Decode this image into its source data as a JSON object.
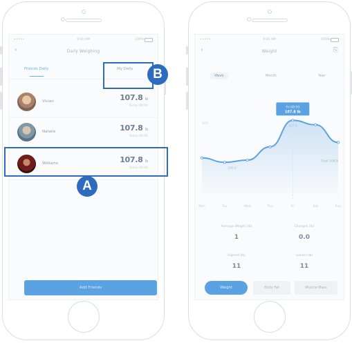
{
  "left_screen": {
    "status": {
      "signal": "•••••",
      "time": "9:41 AM",
      "battery": "100%"
    },
    "nav": {
      "back_icon": "‹",
      "title": "Daily Weighing"
    },
    "tabs": [
      {
        "label": "Friends Daily",
        "active": true
      },
      {
        "label": "My Daily",
        "active": false
      }
    ],
    "friends": [
      {
        "name": "Vivian",
        "value": "107.8",
        "unit": "lb",
        "sub": "Today 08:00"
      },
      {
        "name": "Natalie",
        "value": "107.8",
        "unit": "lb",
        "sub": "Today 08:00"
      },
      {
        "name": "Williams",
        "value": "107.8",
        "unit": "lb",
        "sub": "Today 08:00"
      }
    ],
    "add_button": "Add Friends"
  },
  "right_screen": {
    "status": {
      "signal": "•••••",
      "time": "9:41 AM",
      "battery": "100%"
    },
    "nav": {
      "back_icon": "‹",
      "title": "Weight",
      "share_icon": "⎘"
    },
    "segments": [
      {
        "label": "Week",
        "active": true
      },
      {
        "label": "Month",
        "active": false
      },
      {
        "label": "Year",
        "active": false
      }
    ],
    "chart_data": {
      "type": "line",
      "x": [
        "Mon",
        "Tue",
        "Wed",
        "Thu",
        "Fri",
        "Sat",
        "Sun"
      ],
      "values": [
        106.1,
        105.9,
        106.0,
        106.6,
        107.8,
        107.6,
        106.8
      ],
      "tooltip": {
        "title": "Fri 08:00",
        "value": "107.8 lb"
      },
      "min_label": "106.0",
      "max_label": "107.8",
      "end_label": "Goal 106.8",
      "left_axis_label": "107",
      "color": "#5ba2e2"
    },
    "stats": [
      {
        "label": "Average Weight (lb)",
        "value": "1"
      },
      {
        "label": "Changes (lb)",
        "value": "0.0"
      },
      {
        "label": "Highest (lb)",
        "value": "11"
      },
      {
        "label": "Lowest (lb)",
        "value": "11"
      }
    ],
    "bottom_tabs": [
      {
        "label": "Weight",
        "active": true
      },
      {
        "label": "Body Fat",
        "active": false
      },
      {
        "label": "Muscle Mass",
        "active": false
      }
    ]
  },
  "annotations": {
    "badge_a": "A",
    "badge_b": "B",
    "accent_color": "#2d6bbf"
  }
}
